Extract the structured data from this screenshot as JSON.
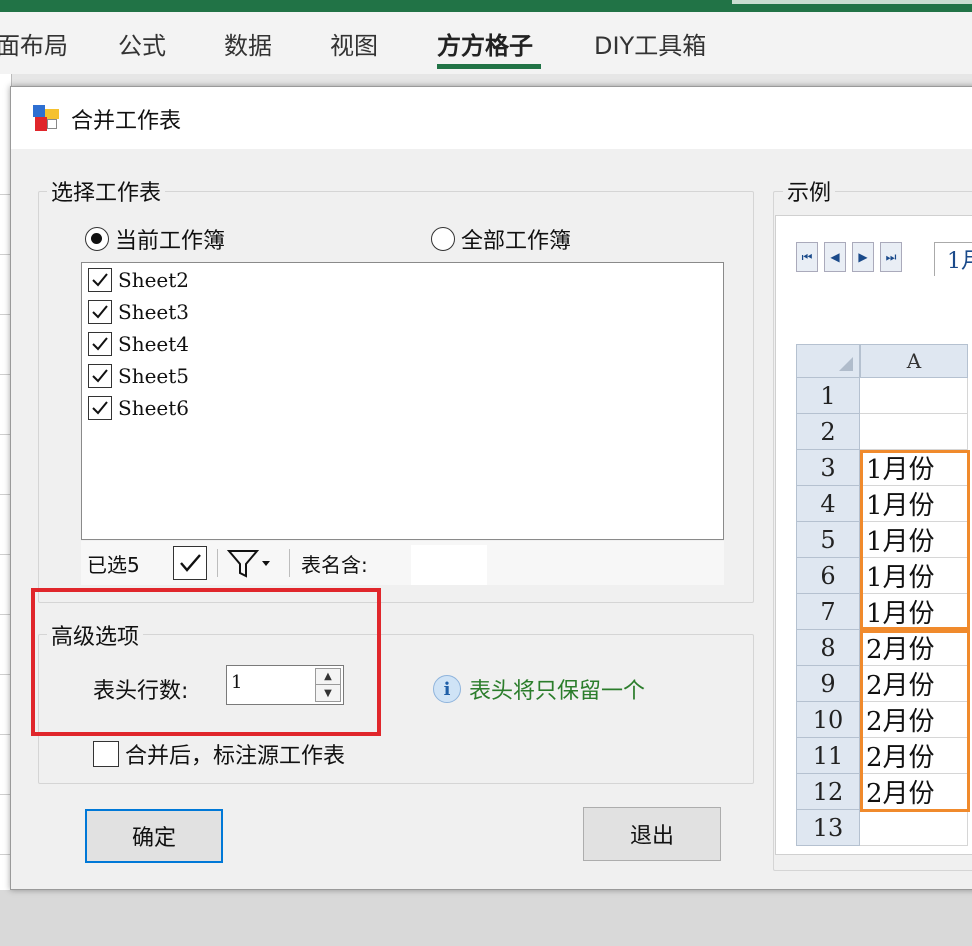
{
  "ribbon": {
    "tabs": [
      {
        "label": "面布局"
      },
      {
        "label": "公式"
      },
      {
        "label": "数据"
      },
      {
        "label": "视图"
      },
      {
        "label": "方方格子"
      },
      {
        "label": "DIY工具箱"
      }
    ],
    "active_tab": "方方格子",
    "accent_color": "#217346"
  },
  "dialog": {
    "title": "合并工作表",
    "select_group": {
      "label": "选择工作表",
      "radio_current": "当前工作簿",
      "radio_all": "全部工作簿",
      "selected_radio": "当前工作簿",
      "sheets": [
        {
          "name": "Sheet2",
          "checked": true
        },
        {
          "name": "Sheet3",
          "checked": true
        },
        {
          "name": "Sheet4",
          "checked": true
        },
        {
          "name": "Sheet5",
          "checked": true
        },
        {
          "name": "Sheet6",
          "checked": true
        }
      ],
      "selected_count": "已选5",
      "name_contains_label": "表名含:",
      "name_contains_value": ""
    },
    "advanced": {
      "label": "高级选项",
      "header_rows_label": "表头行数:",
      "header_rows_value": "1",
      "info_text": "表头将只保留一个",
      "mark_source_label": "合并后，标注源工作表",
      "mark_source_checked": false,
      "highlight_color": "#e0262b"
    },
    "ok_label": "确定",
    "exit_label": "退出",
    "example": {
      "label": "示例",
      "sheet_tab_label": "1月",
      "column_header": "A",
      "rows": [
        {
          "row": "1",
          "value": ""
        },
        {
          "row": "2",
          "value": ""
        },
        {
          "row": "3",
          "value": "1月份"
        },
        {
          "row": "4",
          "value": "1月份"
        },
        {
          "row": "5",
          "value": "1月份"
        },
        {
          "row": "6",
          "value": "1月份"
        },
        {
          "row": "7",
          "value": "1月份"
        },
        {
          "row": "8",
          "value": "2月份"
        },
        {
          "row": "9",
          "value": "2月份"
        },
        {
          "row": "10",
          "value": "2月份"
        },
        {
          "row": "11",
          "value": "2月份"
        },
        {
          "row": "12",
          "value": "2月份"
        },
        {
          "row": "13",
          "value": ""
        }
      ],
      "highlight_color": "#f08a2c"
    }
  }
}
